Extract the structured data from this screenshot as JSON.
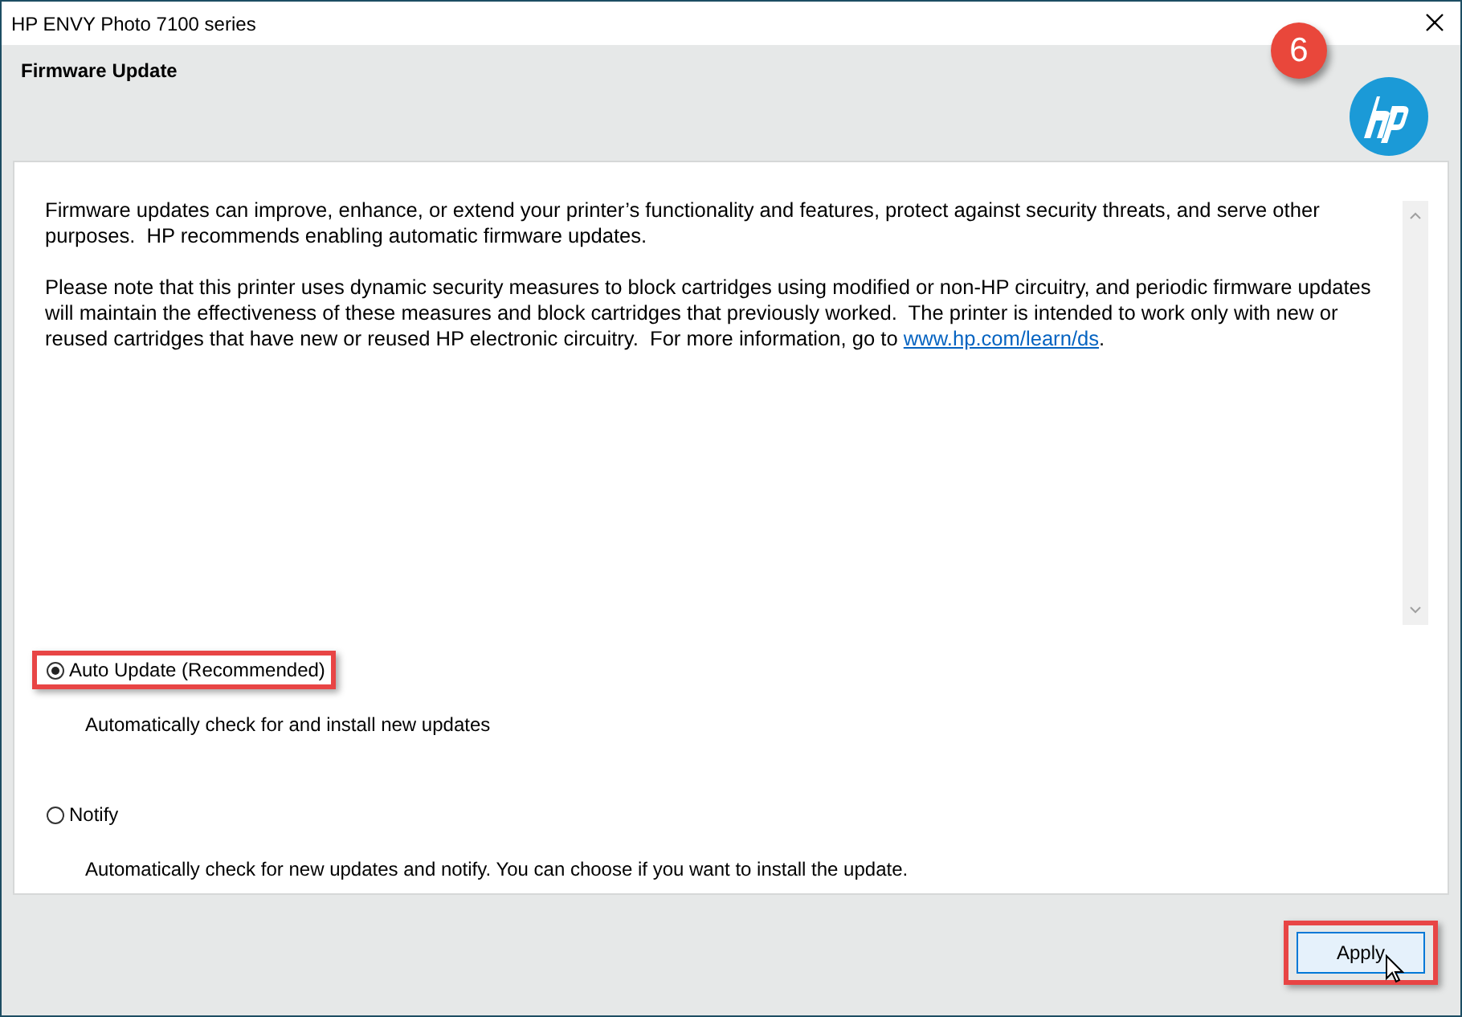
{
  "window": {
    "title": "HP ENVY Photo 7100 series"
  },
  "header": {
    "title": "Firmware Update",
    "step_badge": "6"
  },
  "paragraphs": [
    {
      "text": "Firmware updates can improve, enhance, or extend your printer’s functionality and features, protect against security threats, and serve other purposes.  HP recommends enabling automatic firmware updates."
    },
    {
      "text": "Please note that this printer uses dynamic security measures to block cartridges using modified or non-HP circuitry, and periodic firmware updates will maintain the effectiveness of these measures and block cartridges that previously worked.  The printer is intended to work only with new or reused cartridges that have new or reused HP electronic circuitry.  For more information, go to ",
      "link": "www.hp.com/learn/ds",
      "text_after": "."
    }
  ],
  "options": [
    {
      "label": "Auto Update (Recommended)",
      "description": "Automatically check for and install new updates",
      "selected": true,
      "highlighted": true
    },
    {
      "label": "Notify",
      "description": "Automatically check for new updates and notify. You can choose if you want to install the update.",
      "selected": false,
      "highlighted": false
    }
  ],
  "button": {
    "label": "Apply",
    "highlighted": true
  }
}
